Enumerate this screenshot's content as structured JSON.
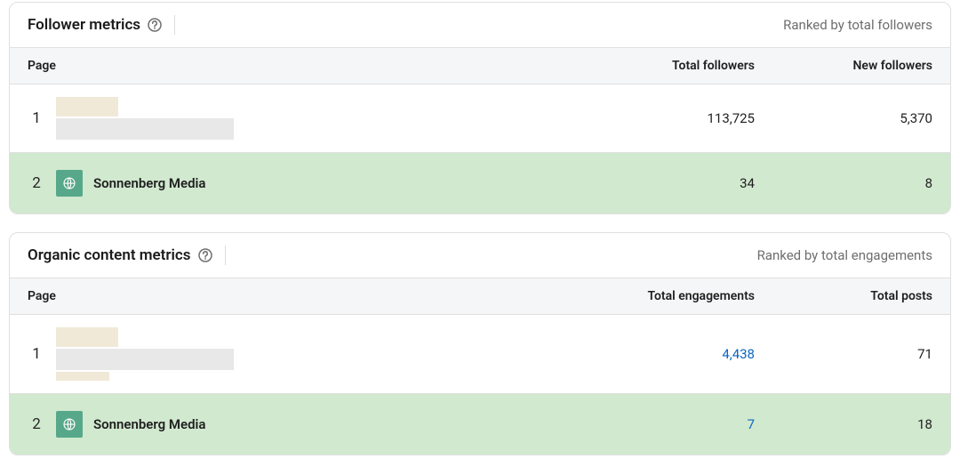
{
  "colors": {
    "accent": "#0a66c2",
    "highlightRow": "#d1e9cf",
    "avatarBg": "#57a88a"
  },
  "panels": {
    "followers": {
      "title": "Follower metrics",
      "rankedBy": "Ranked by total followers",
      "headers": {
        "page": "Page",
        "col1": "Total followers",
        "col2": "New followers"
      },
      "rows": {
        "r1": {
          "rank": "1",
          "total": "113,725",
          "new": "5,370"
        },
        "r2": {
          "rank": "2",
          "name": "Sonnenberg Media",
          "total": "34",
          "new": "8"
        }
      }
    },
    "organic": {
      "title": "Organic content metrics",
      "rankedBy": "Ranked by total engagements",
      "headers": {
        "page": "Page",
        "col1": "Total engagements",
        "col2": "Total posts"
      },
      "rows": {
        "r1": {
          "rank": "1",
          "eng": "4,438",
          "posts": "71"
        },
        "r2": {
          "rank": "2",
          "name": "Sonnenberg Media",
          "eng": "7",
          "posts": "18"
        }
      }
    }
  }
}
